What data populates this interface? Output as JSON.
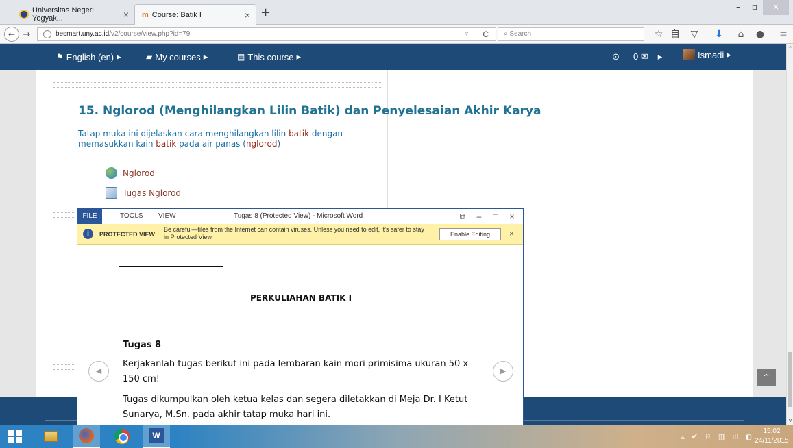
{
  "browser": {
    "tabs": [
      {
        "label": "Universitas Negeri Yogyak...",
        "close": "×"
      },
      {
        "label": "Course: Batik I",
        "close": "×",
        "favicon": "m"
      }
    ],
    "new_tab": "+",
    "window_controls": {
      "minimize": "–",
      "maximize": "▫",
      "close": "×"
    },
    "nav": {
      "back": "←",
      "forward": "→",
      "reload": "C",
      "url_host": "besmart.uny.ac.id",
      "url_path": "/v2/course/view.php?id=79",
      "url_drop": "▿"
    },
    "search_placeholder": "Search",
    "toolbar_icons": [
      "star-icon",
      "reading-list-icon",
      "pocket-icon",
      "download-icon",
      "home-icon",
      "chat-icon",
      "menu-icon"
    ],
    "toolbar_glyphs": [
      "☆",
      "自",
      "▽",
      "⬇",
      "⌂",
      "●",
      "≡"
    ]
  },
  "moodle": {
    "menu": [
      {
        "label": "English (en)",
        "icon": "⚑"
      },
      {
        "label": "My courses",
        "icon": "▰"
      },
      {
        "label": "This course",
        "icon": "▤"
      }
    ],
    "caret": "▸",
    "notify_icon": "⊙",
    "messages": "0 ✉",
    "user": "Ismadi",
    "section_title": "15. Nglorod (Menghilangkan Lilin Batik) dan Penyelesaian Akhir Karya",
    "desc_parts": [
      "Tatap muka ini dijelaskan cara menghilangkan lilin ",
      "batik",
      " dengan memasukkan kain ",
      "batik",
      " pada air panas (",
      "nglorod",
      ")"
    ],
    "activities": [
      {
        "label": "Nglorod",
        "type": "url"
      },
      {
        "label": "Tugas Nglorod",
        "type": "assign"
      }
    ],
    "back_to_top": "^"
  },
  "word": {
    "menus": [
      "FILE",
      "TOOLS",
      "VIEW"
    ],
    "title": "Tugas 8 (Protected View) - Microsoft Word",
    "controls": [
      "⧉",
      "–",
      "□",
      "×"
    ],
    "protected_label": "PROTECTED VIEW",
    "protected_icon": "i",
    "protected_msg": "Be careful—files from the Internet can contain viruses. Unless you need to edit, it's safer to stay in Protected View.",
    "enable_button": "Enable Editing",
    "close_bar": "×",
    "doc": {
      "heading": "PERKULIAHAN BATIK I",
      "subheading": "Tugas 8",
      "paragraphs": [
        "Kerjakanlah tugas berikut ini pada lembaran kain mori primisima ukuran 50 x 150 cm!",
        "Tugas dikumpulkan oleh ketua kelas dan segera diletakkan di Meja Dr. I Ketut Sunarya, M.Sn. pada akhir tatap muka hari ini."
      ],
      "prev_arrow": "◀",
      "next_arrow": "▶"
    }
  },
  "taskbar": {
    "apps": [
      "file-explorer",
      "firefox",
      "chrome",
      "word"
    ],
    "word_glyph": "W",
    "tray": [
      "▵",
      "✔",
      "⚐",
      "▥",
      "ıll",
      "◐"
    ],
    "time": "15:02",
    "date": "24/11/2015"
  }
}
